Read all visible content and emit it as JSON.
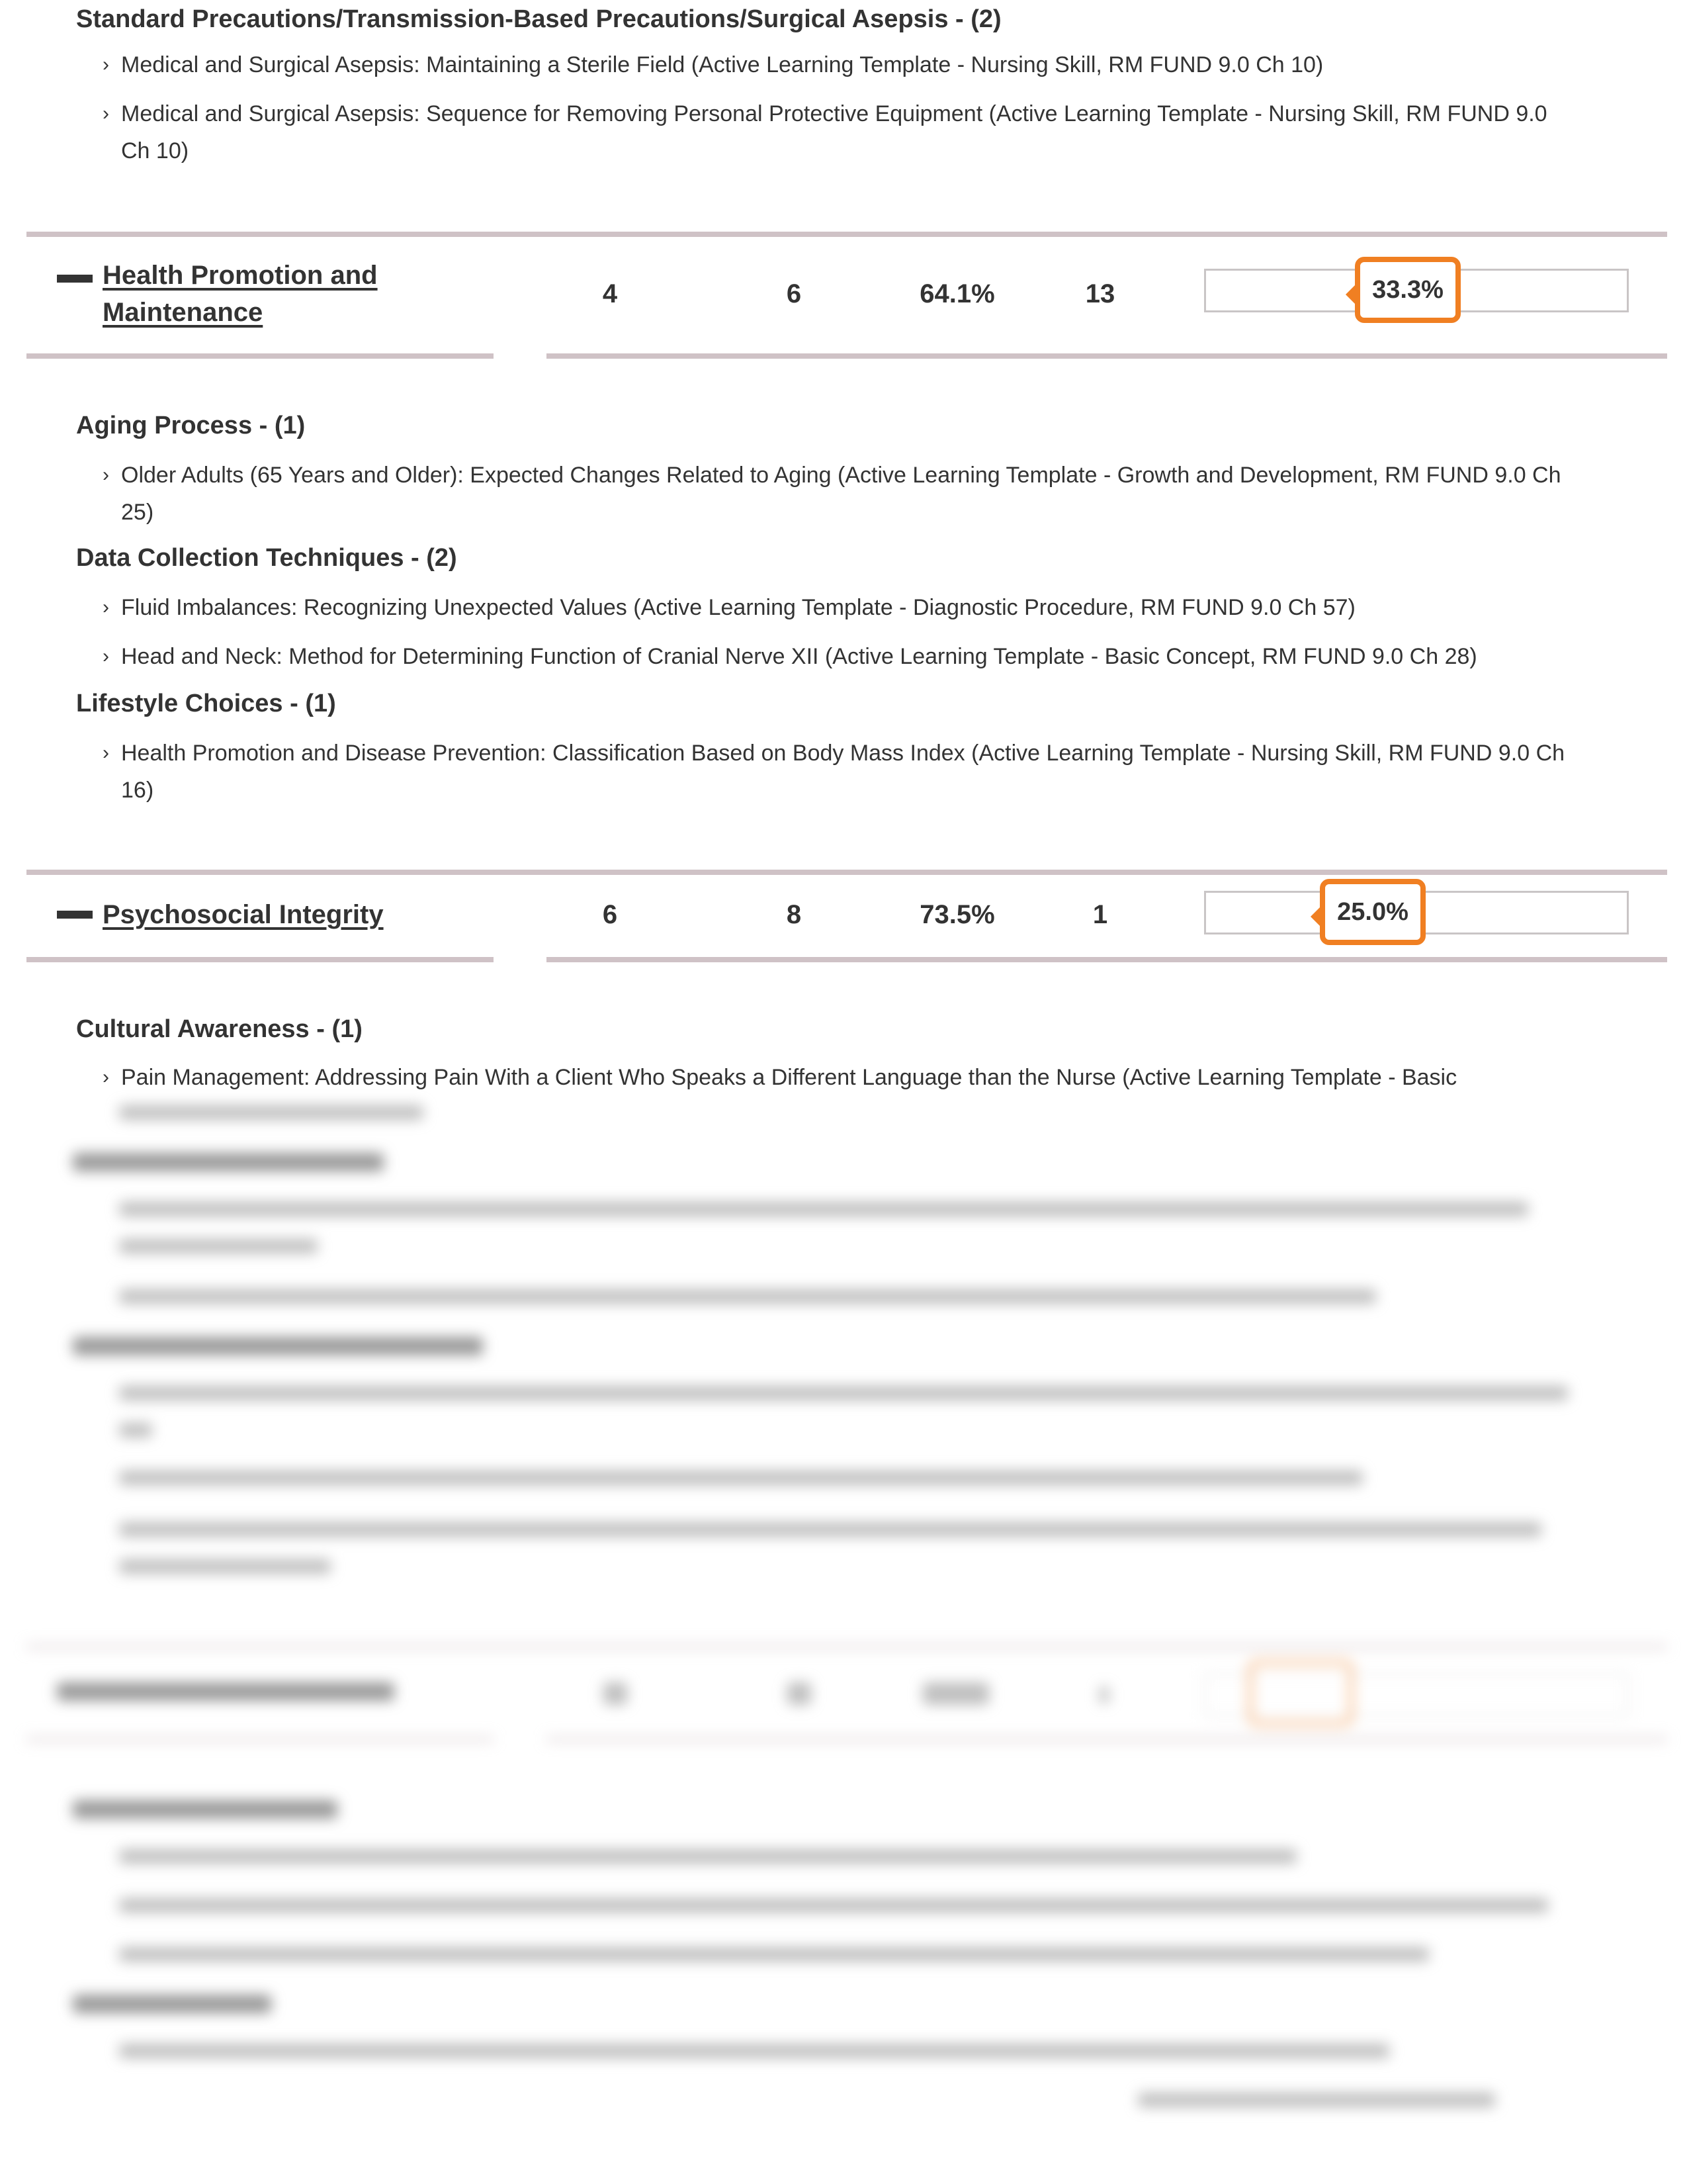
{
  "section_top": {
    "topic": "Standard Precautions/Transmission-Based Precautions/Surgical Asepsis - (2)",
    "items": [
      "Medical and Surgical Asepsis: Maintaining a Sterile Field (Active Learning Template - Nursing Skill, RM FUND 9.0 Ch 10)",
      "Medical and Surgical Asepsis: Sequence for Removing Personal Protective Equipment (Active Learning Template - Nursing Skill, RM FUND 9.0 Ch 10)"
    ]
  },
  "rows": [
    {
      "name": "Health Promotion and Maintenance",
      "name_line1": "Health Promotion and",
      "name_line2": "Maintenance",
      "col1": "4",
      "col2": "6",
      "col3": "64.1%",
      "col4": "13",
      "score": "33.3%",
      "score_value": 33.3,
      "accent": "#f07f22",
      "topics": [
        {
          "title": "Aging Process - (1)",
          "items": [
            "Older Adults (65 Years and Older): Expected Changes Related to Aging (Active Learning Template - Growth and Development, RM FUND 9.0 Ch 25)"
          ]
        },
        {
          "title": "Data Collection Techniques - (2)",
          "items": [
            "Fluid Imbalances: Recognizing Unexpected Values (Active Learning Template - Diagnostic Procedure, RM FUND 9.0 Ch 57)",
            "Head and Neck: Method for Determining Function of Cranial Nerve XII (Active Learning Template - Basic Concept, RM FUND 9.0 Ch 28)"
          ]
        },
        {
          "title": "Lifestyle Choices - (1)",
          "items": [
            "Health Promotion and Disease Prevention: Classification Based on Body Mass Index (Active Learning Template - Nursing Skill, RM FUND 9.0 Ch 16)"
          ]
        }
      ]
    },
    {
      "name": "Psychosocial Integrity",
      "col1": "6",
      "col2": "8",
      "col3": "73.5%",
      "col4": "1",
      "score": "25.0%",
      "score_value": 25.0,
      "accent": "#f07f22",
      "topics": [
        {
          "title": "Cultural Awareness - (1)",
          "items": [
            "Pain Management: Addressing Pain With a Client Who Speaks a Different Language than the Nurse (Active Learning Template - Basic"
          ]
        }
      ]
    }
  ],
  "chevron_glyph": "›"
}
